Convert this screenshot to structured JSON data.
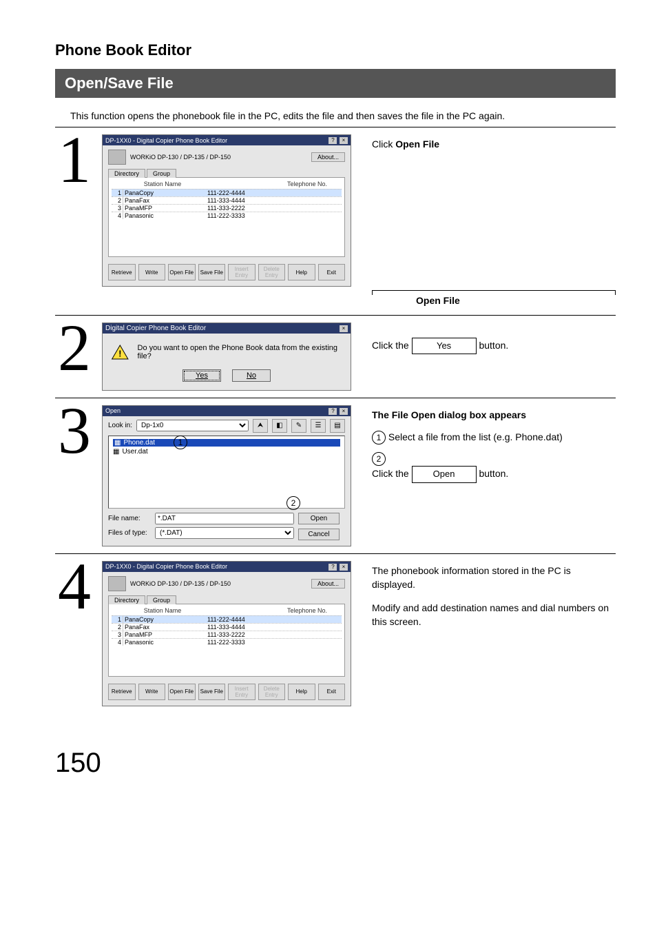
{
  "section_title": "Phone Book Editor",
  "subsection_bar": "Open/Save File",
  "intro": "This function opens the phonebook file in the PC, edits the file and then saves the file in the PC again.",
  "page_number": "150",
  "step1": {
    "num": "1",
    "text_prefix": "Click ",
    "text_bold": "Open File",
    "callout_label": "Open File",
    "app": {
      "title": "DP-1XX0 - Digital Copier Phone Book Editor",
      "model": "WORKiO DP-130 / DP-135 / DP-150",
      "about": "About...",
      "tabs": {
        "directory": "Directory",
        "group": "Group"
      },
      "columns": {
        "name": "Station Name",
        "tel": "Telephone No."
      },
      "rows": [
        {
          "idx": "1",
          "name": "PanaCopy",
          "tel": "111-222-4444"
        },
        {
          "idx": "2",
          "name": "PanaFax",
          "tel": "111-333-4444"
        },
        {
          "idx": "3",
          "name": "PanaMFP",
          "tel": "111-333-2222"
        },
        {
          "idx": "4",
          "name": "Panasonic",
          "tel": "111-222-3333"
        }
      ],
      "buttons": {
        "retrieve": "Retrieve",
        "write": "Write",
        "openfile": "Open File",
        "savefile": "Save File",
        "insert": "Insert Entry",
        "delete": "Delete Entry",
        "help": "Help",
        "exit": "Exit"
      }
    }
  },
  "step2": {
    "num": "2",
    "dialog": {
      "title": "Digital Copier Phone Book Editor",
      "message": "Do you want to open the Phone Book data from the existing file?",
      "yes": "Yes",
      "no": "No"
    },
    "text_click_the": "Click the ",
    "text_button": " button.",
    "btn_label": "Yes"
  },
  "step3": {
    "num": "3",
    "heading": "The File Open dialog box appears",
    "sub1_num": "1",
    "sub1_text": "Select a file from the list (e.g. Phone.dat)",
    "sub2_num": "2",
    "sub2_click_the": "Click the ",
    "sub2_button": " button.",
    "sub2_btn_label": "Open",
    "dialog": {
      "title": "Open",
      "look_in_label": "Look in:",
      "look_in_value": "Dp-1x0",
      "files": [
        {
          "name": "Phone.dat",
          "selected": true
        },
        {
          "name": "User.dat",
          "selected": false
        }
      ],
      "filename_label": "File name:",
      "filename_value": "*.DAT",
      "filetype_label": "Files of type:",
      "filetype_value": "(*.DAT)",
      "open": "Open",
      "cancel": "Cancel"
    }
  },
  "step4": {
    "num": "4",
    "para1": "The phonebook information stored in the PC is displayed.",
    "para2": "Modify and add destination names and dial numbers on this screen."
  }
}
